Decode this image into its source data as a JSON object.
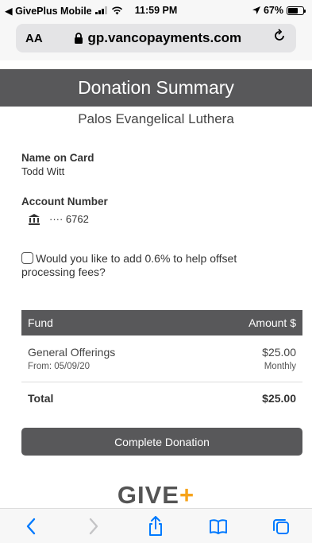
{
  "status_bar": {
    "back_app": "◀ GivePlus Mobile",
    "time": "11:59 PM",
    "battery": "67%",
    "battery_level": 0.67
  },
  "browser": {
    "reader_label": "AA",
    "url": "gp.vancopayments.com"
  },
  "page": {
    "title": "Donation Summary",
    "organization": "Palos Evangelical Luthera",
    "name_label": "Name on Card",
    "name_value": "Todd Witt",
    "account_label": "Account Number",
    "account_value": "···· 6762",
    "fee_question": "Would you like to add 0.6% to help offset processing fees?",
    "table": {
      "col_fund": "Fund",
      "col_amount": "Amount $",
      "rows": [
        {
          "fund": "General Offerings",
          "amount": "$25.00",
          "from": "From: 05/09/20",
          "frequency": "Monthly"
        }
      ],
      "total_label": "Total",
      "total_value": "$25.00"
    },
    "complete_button": "Complete Donation",
    "logo_text": "GIVE",
    "logo_plus": "+"
  },
  "colors": {
    "accent": "#58585a",
    "logo_plus": "#f6a31b",
    "ios_blue": "#007aff"
  }
}
